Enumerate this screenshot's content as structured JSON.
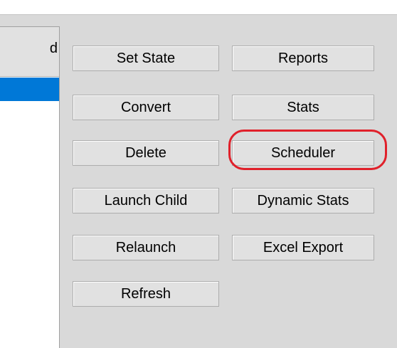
{
  "list": {
    "header_text": "d"
  },
  "buttons": {
    "set_state": "Set State",
    "reports": "Reports",
    "convert": "Convert",
    "stats": "Stats",
    "delete": "Delete",
    "scheduler": "Scheduler",
    "launch_child": "Launch Child",
    "dynamic_stats": "Dynamic Stats",
    "relaunch": "Relaunch",
    "excel_export": "Excel Export",
    "refresh": "Refresh"
  },
  "annotation": {
    "highlighted_button": "Scheduler",
    "color": "#e0202a"
  },
  "colors": {
    "selection": "#0078d7",
    "button_face": "#e1e1e1",
    "panel": "#d9d9d9"
  }
}
